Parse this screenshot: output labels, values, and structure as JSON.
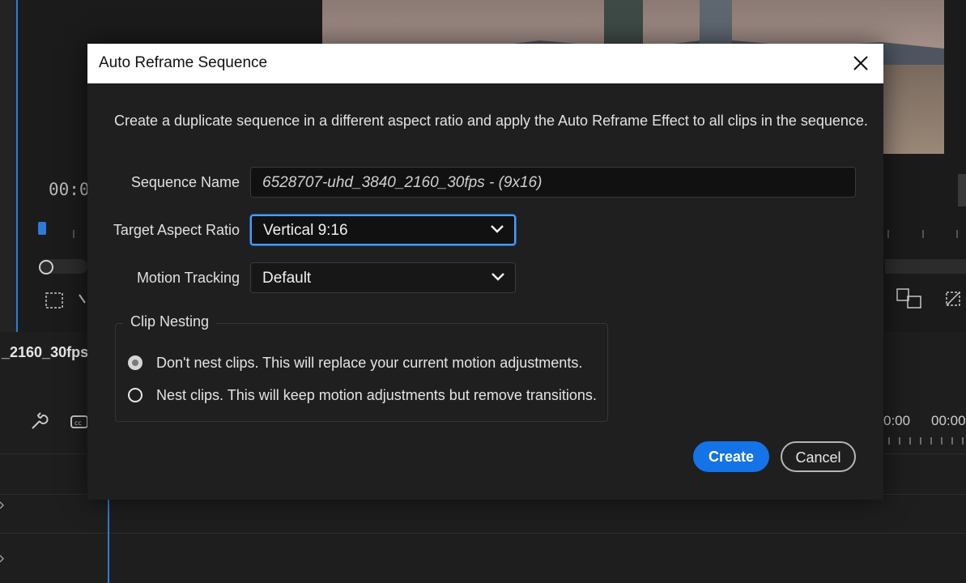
{
  "background": {
    "timecode_left": "00:0",
    "sequence_label": "_2160_30fps",
    "timecode_right_1": "0:00",
    "timecode_right_2": "00:00"
  },
  "dialog": {
    "title": "Auto Reframe Sequence",
    "description": "Create a duplicate sequence in a different aspect ratio and apply the Auto Reframe Effect to all clips in the sequence.",
    "sequence_name": {
      "label": "Sequence Name",
      "value": "6528707-uhd_3840_2160_30fps - (9x16)"
    },
    "target_aspect_ratio": {
      "label": "Target Aspect Ratio",
      "value": "Vertical 9:16"
    },
    "motion_tracking": {
      "label": "Motion Tracking",
      "value": "Default"
    },
    "clip_nesting": {
      "title": "Clip Nesting",
      "options": [
        {
          "label": "Don't nest clips. This will replace your current motion adjustments.",
          "selected": true
        },
        {
          "label": "Nest clips. This will keep motion adjustments but remove transitions.",
          "selected": false
        }
      ]
    },
    "buttons": {
      "create": "Create",
      "cancel": "Cancel"
    }
  },
  "colors": {
    "accent": "#1473e6",
    "focus_ring": "#4b9cf5",
    "dialog_bg": "#1f1f1f",
    "titlebar_bg": "#ffffff"
  }
}
